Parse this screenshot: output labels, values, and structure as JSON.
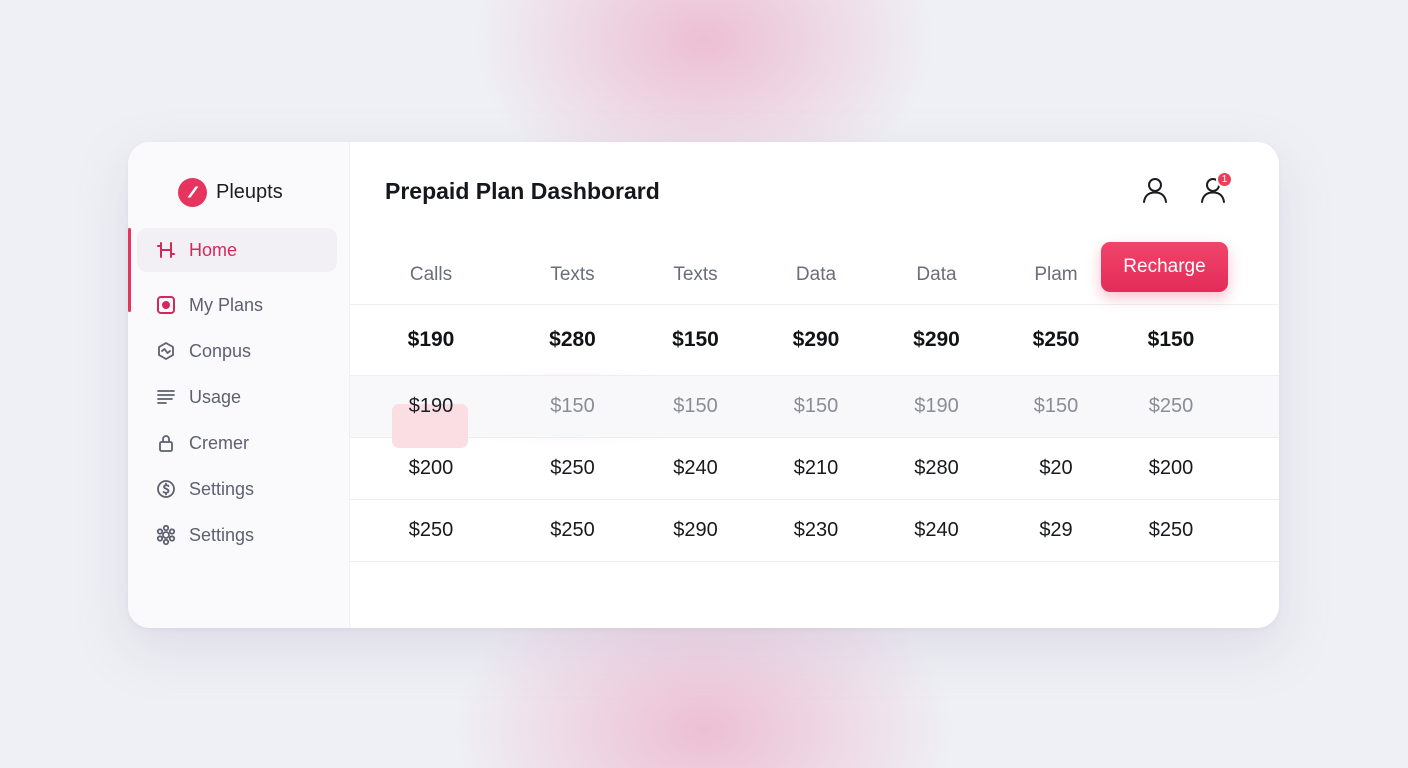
{
  "brand": {
    "name": "Pleupts",
    "accent": "#e5345e"
  },
  "header": {
    "title": "Prepaid Plan Dashborard"
  },
  "sidebar": {
    "items": [
      {
        "label": "Home",
        "icon": "home-icon",
        "active": true
      },
      {
        "label": "My Plans",
        "icon": "plans-icon"
      },
      {
        "label": "Conpus",
        "icon": "coupon-icon"
      },
      {
        "label": "Usage",
        "icon": "usage-icon"
      },
      {
        "label": "Cremer",
        "icon": "lock-icon"
      },
      {
        "label": "Settings",
        "icon": "billing-icon"
      },
      {
        "label": "Settings",
        "icon": "gear-icon"
      }
    ]
  },
  "top_icons": {
    "notification_count": "1"
  },
  "actions": {
    "recharge_label": "Recharge"
  },
  "table": {
    "columns": [
      "Calls",
      "Texts",
      "Texts",
      "Data",
      "Data",
      "Plam"
    ],
    "rows": [
      [
        "$190",
        "$280",
        "$150",
        "$290",
        "$290",
        "$250",
        "$150"
      ],
      [
        "$190",
        "$150",
        "$150",
        "$150",
        "$190",
        "$150",
        "$250"
      ],
      [
        "$200",
        "$250",
        "$240",
        "$210",
        "$280",
        "$20",
        "$200"
      ],
      [
        "$250",
        "$250",
        "$290",
        "$230",
        "$240",
        "$29",
        "$250"
      ]
    ]
  }
}
